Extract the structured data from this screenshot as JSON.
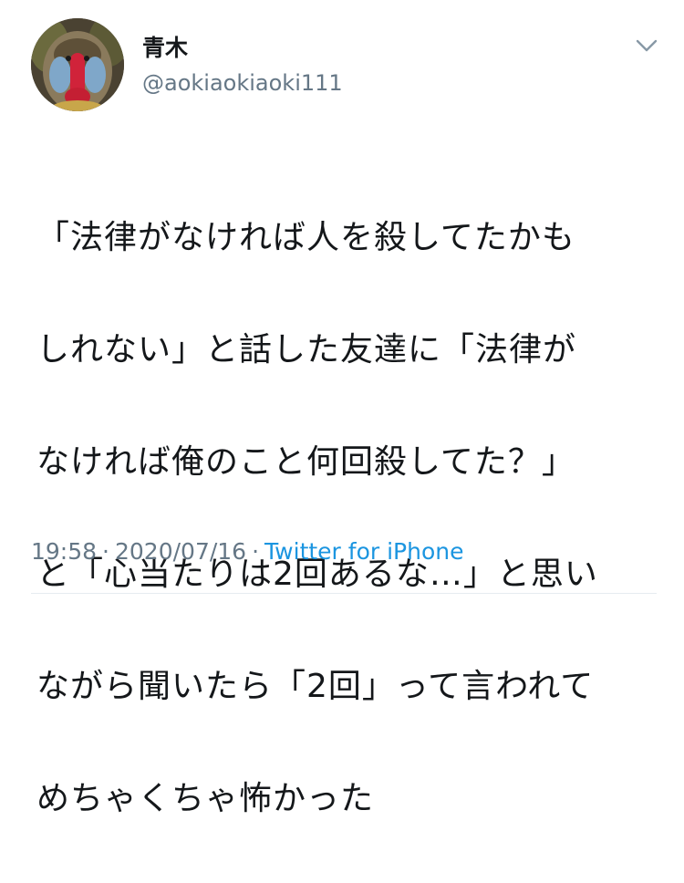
{
  "user": {
    "display_name": "青木",
    "handle": "@aokiaokiaoki111",
    "avatar_icon": "mandrill-avatar"
  },
  "menu": {
    "caret_icon": "chevron-down-icon"
  },
  "tweet": {
    "lines": [
      "「法律がなければ人を殺してたかも",
      "しれない」と話した友達に「法律が",
      "なければ俺のこと何回殺してた？」",
      "と「心当たりは2回あるな…」と思い",
      "ながら聞いたら「2回」って言われて",
      "めちゃくちゃ怖かった"
    ]
  },
  "meta": {
    "time": "19:58",
    "separator": "·",
    "date": "2020/07/16",
    "separator2": "·",
    "source": "Twitter for iPhone"
  },
  "colors": {
    "text": "#14171a",
    "secondary": "#657786",
    "link": "#1b95e0"
  }
}
